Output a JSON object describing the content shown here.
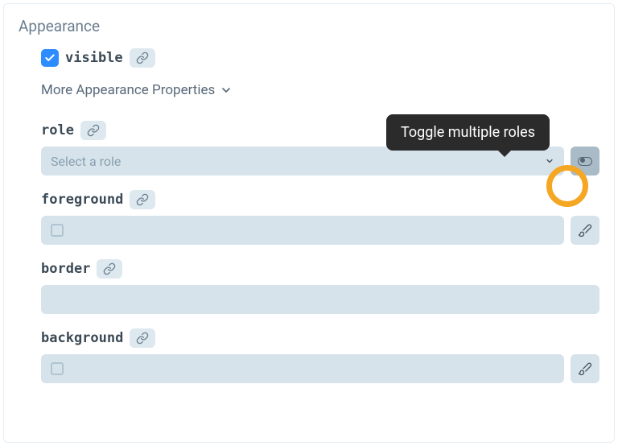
{
  "section": {
    "title": "Appearance"
  },
  "visible": {
    "label": "visible",
    "checked": true
  },
  "more": {
    "label": "More Appearance Properties"
  },
  "role": {
    "label": "role",
    "placeholder": "Select a role"
  },
  "foreground": {
    "label": "foreground"
  },
  "border": {
    "label": "border"
  },
  "background": {
    "label": "background"
  },
  "tooltip": {
    "text": "Toggle multiple roles"
  }
}
